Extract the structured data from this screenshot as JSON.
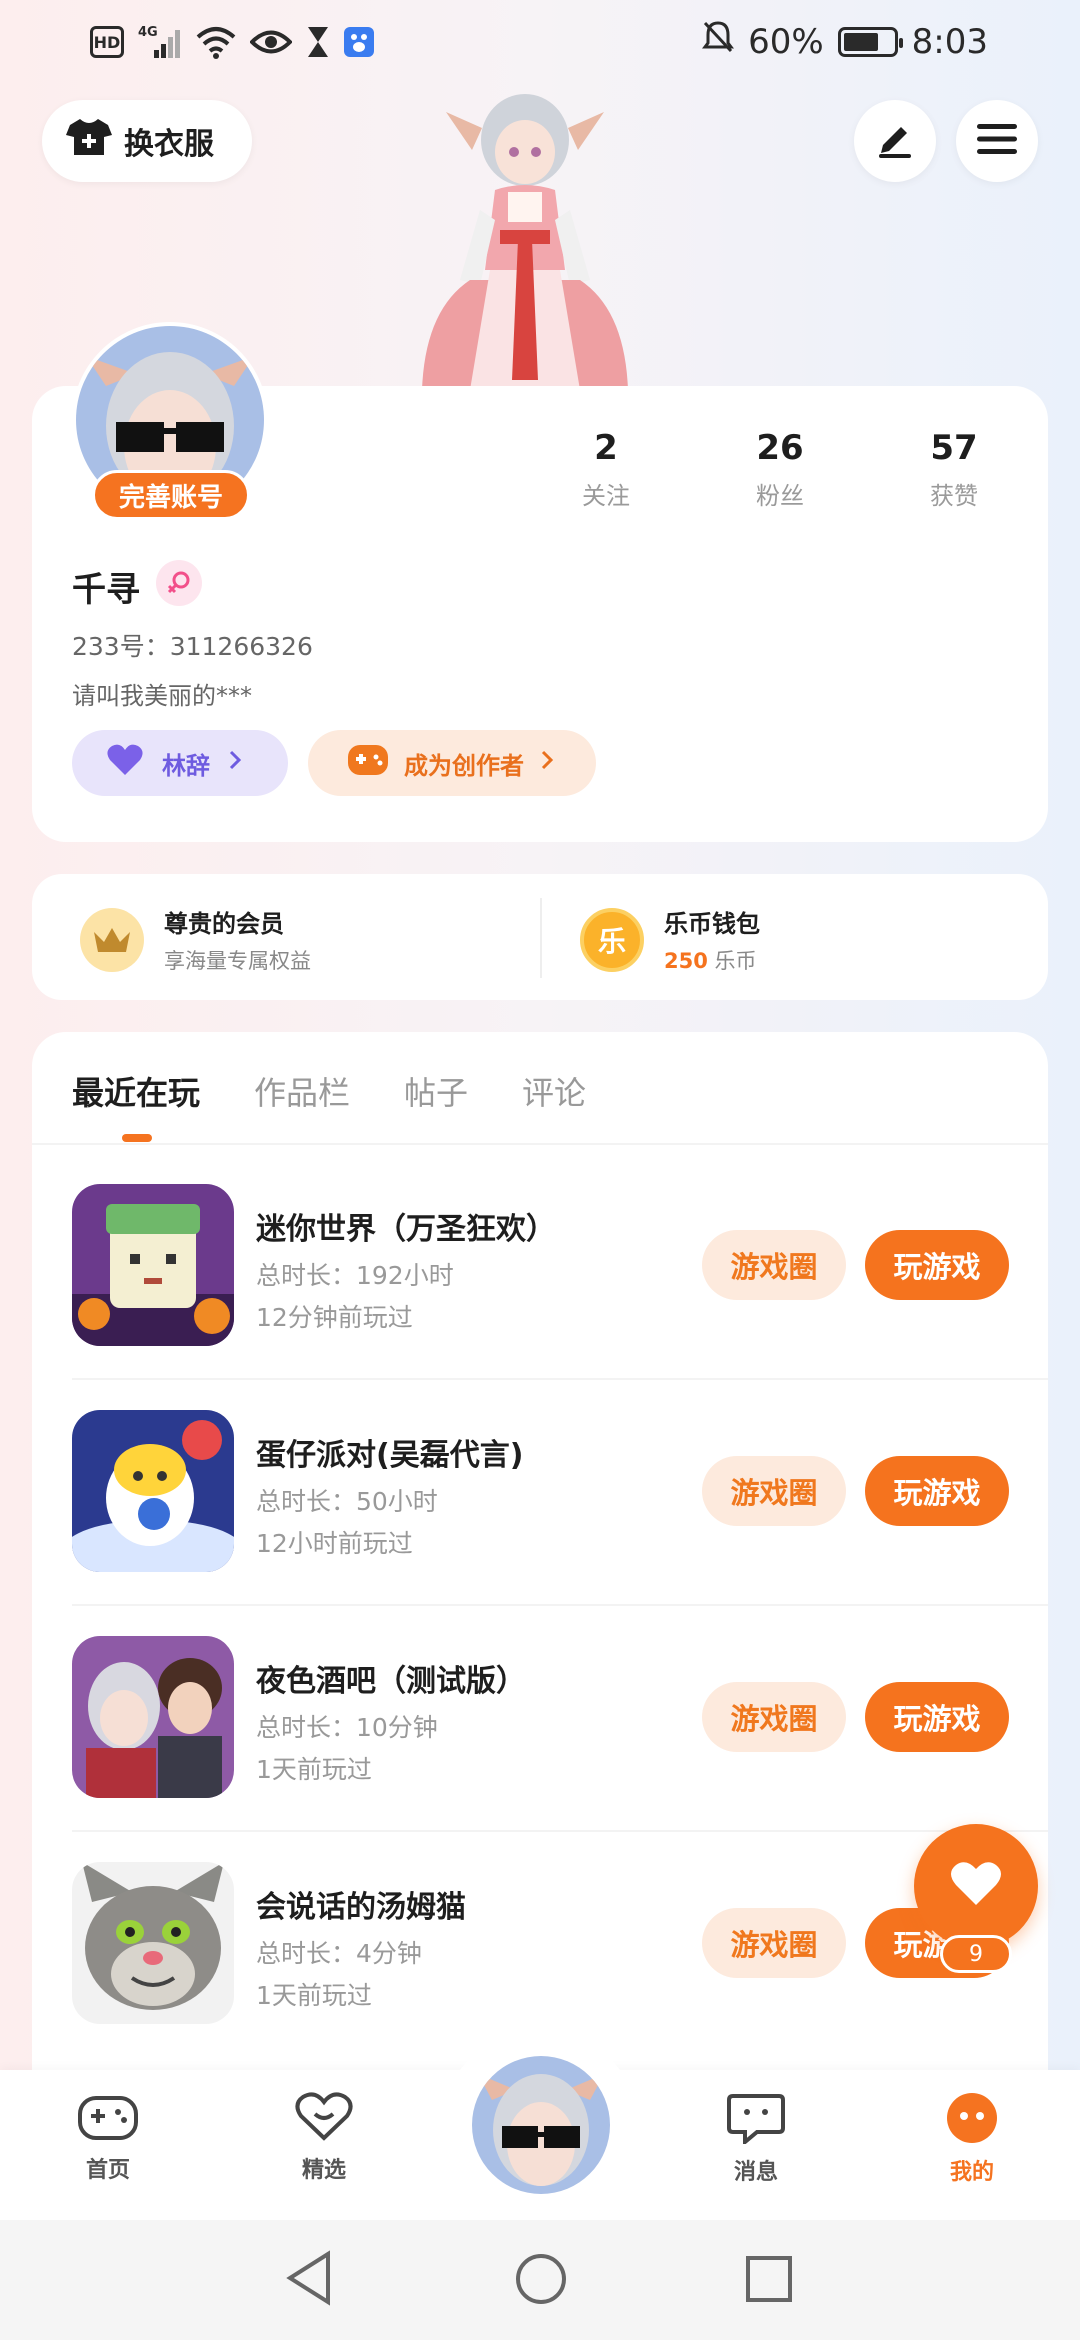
{
  "status_bar": {
    "hd": "HD",
    "network": "4G",
    "battery": "60%",
    "time": "8:03"
  },
  "top_bar": {
    "outfit_label": "换衣服"
  },
  "profile": {
    "complete_label": "完善账号",
    "stats": [
      {
        "value": "2",
        "label": "关注"
      },
      {
        "value": "26",
        "label": "粉丝"
      },
      {
        "value": "57",
        "label": "获赞"
      }
    ],
    "name": "千寻",
    "uid": "233号：311266326",
    "bio": "请叫我美丽的***",
    "guard_label": "林辞",
    "creator_label": "成为创作者"
  },
  "member": {
    "title": "尊贵的会员",
    "subtitle": "享海量专属权益"
  },
  "wallet": {
    "coin_glyph": "乐",
    "title": "乐币钱包",
    "amount": "250",
    "unit": "乐币"
  },
  "tabs": [
    "最近在玩",
    "作品栏",
    "帖子",
    "评论"
  ],
  "games": [
    {
      "name": "迷你世界（万圣狂欢）",
      "duration": "总时长：192小时",
      "last_played": "12分钟前玩过",
      "circle_label": "游戏圈",
      "play_label": "玩游戏"
    },
    {
      "name": "蛋仔派对(吴磊代言)",
      "duration": "总时长：50小时",
      "last_played": "12小时前玩过",
      "circle_label": "游戏圈",
      "play_label": "玩游戏"
    },
    {
      "name": "夜色酒吧（测试版）",
      "duration": "总时长：10分钟",
      "last_played": "1天前玩过",
      "circle_label": "游戏圈",
      "play_label": "玩游戏"
    },
    {
      "name": "会说话的汤姆猫",
      "duration": "总时长：4分钟",
      "last_played": "1天前玩过",
      "circle_label": "游戏圈",
      "play_label": "玩游戏"
    }
  ],
  "floating": {
    "count": "9"
  },
  "bottom_nav": [
    {
      "label": "首页"
    },
    {
      "label": "精选"
    },
    {
      "label": "消息"
    },
    {
      "label": "我的"
    }
  ],
  "colors": {
    "accent": "#f5731e",
    "accent_light": "#fdeadd",
    "purple": "#6e5be0"
  }
}
